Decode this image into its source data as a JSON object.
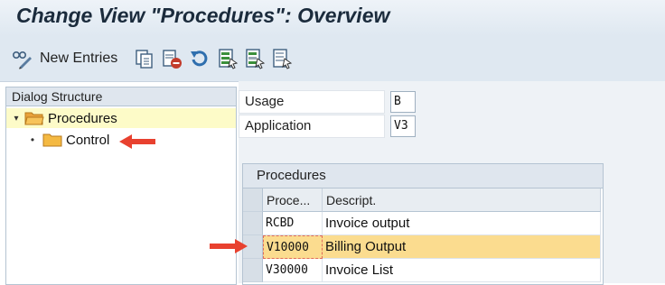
{
  "window": {
    "title": "Change View \"Procedures\": Overview"
  },
  "toolbar": {
    "new_entries_label": "New Entries",
    "icons": [
      "display-change-icon",
      "copy-icon",
      "delete-icon",
      "undo-icon",
      "select-all-icon",
      "select-block-icon",
      "deselect-all-icon"
    ]
  },
  "dialog_structure": {
    "header": "Dialog Structure",
    "items": [
      {
        "label": "Procedures",
        "expanded": true,
        "selected": true
      },
      {
        "label": "Control",
        "selected": false
      }
    ]
  },
  "fields": {
    "usage": {
      "label": "Usage",
      "value": "B"
    },
    "application": {
      "label": "Application",
      "value": "V3"
    }
  },
  "procedures_table": {
    "title": "Procedures",
    "columns": [
      "Proce...",
      "Descript."
    ],
    "rows": [
      {
        "procedure": "RCBD",
        "description": "Invoice output",
        "highlighted": false
      },
      {
        "procedure": "V10000",
        "description": "Billing Output",
        "highlighted": true
      },
      {
        "procedure": "V30000",
        "description": "Invoice List",
        "highlighted": false
      }
    ]
  },
  "colors": {
    "title_bar": "#dfe8f1",
    "selected_tree_item": "#fdfbc8",
    "highlighted_row": "#fbdc8f",
    "annotation_arrow": "#e8412f"
  }
}
